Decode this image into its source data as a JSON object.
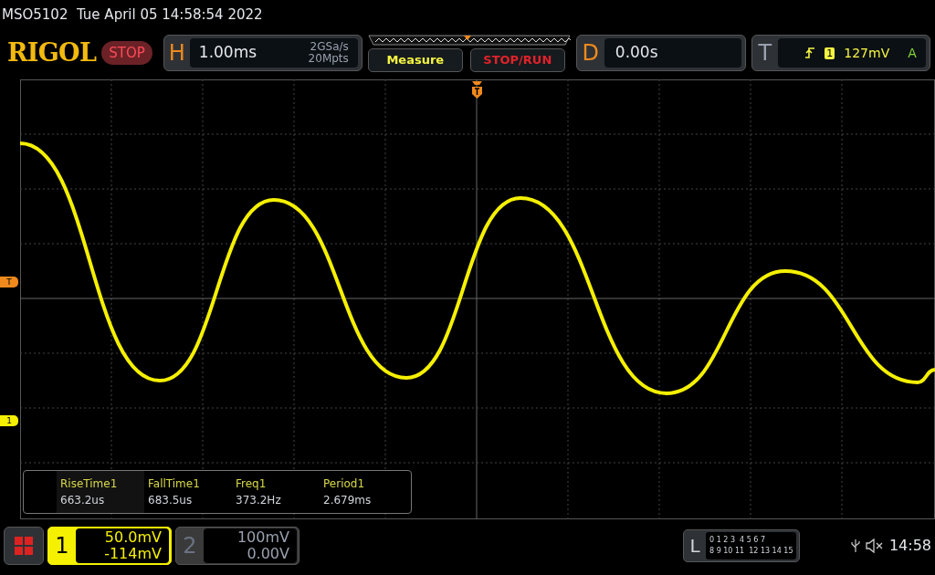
{
  "status_line": "MSO5102  Tue April 05 14:58:54 2022",
  "header": {
    "logo": "RIGOL",
    "run_state": "STOP",
    "run_stopped": true,
    "horizontal": {
      "letter": "H",
      "timebase": "1.00ms",
      "sample_rate": "2GSa/s",
      "memory_depth": "20Mpts"
    },
    "buttons": [
      {
        "label": "Measure",
        "kind": "measure"
      },
      {
        "label": "STOP/RUN",
        "kind": "run"
      }
    ],
    "delay": {
      "letter": "D",
      "value": "0.00s"
    },
    "trigger": {
      "letter": "T",
      "channel": "1",
      "level": "127mV",
      "mode": "A"
    }
  },
  "markers": [
    {
      "label": "T",
      "kind": "trigger"
    },
    {
      "label": "1",
      "kind": "channel"
    }
  ],
  "measurements": [
    {
      "name": "RiseTime1",
      "value": "663.2us"
    },
    {
      "name": "FallTime1",
      "value": "683.5us"
    },
    {
      "name": "Freq1",
      "value": "373.2Hz"
    },
    {
      "name": "Period1",
      "value": "2.679ms"
    }
  ],
  "channels": [
    {
      "number": "1",
      "scale": "50.0mV",
      "offset": "-114mV",
      "selected": true
    },
    {
      "number": "2",
      "scale": "100mV",
      "offset": "0.00V",
      "selected": false
    }
  ],
  "logic": {
    "letter": "L",
    "rows": [
      [
        "0 1 2 3",
        "4 5 6 7"
      ],
      [
        "8 9 10 11",
        "12 13 14 15"
      ]
    ]
  },
  "clock": "14:58"
}
